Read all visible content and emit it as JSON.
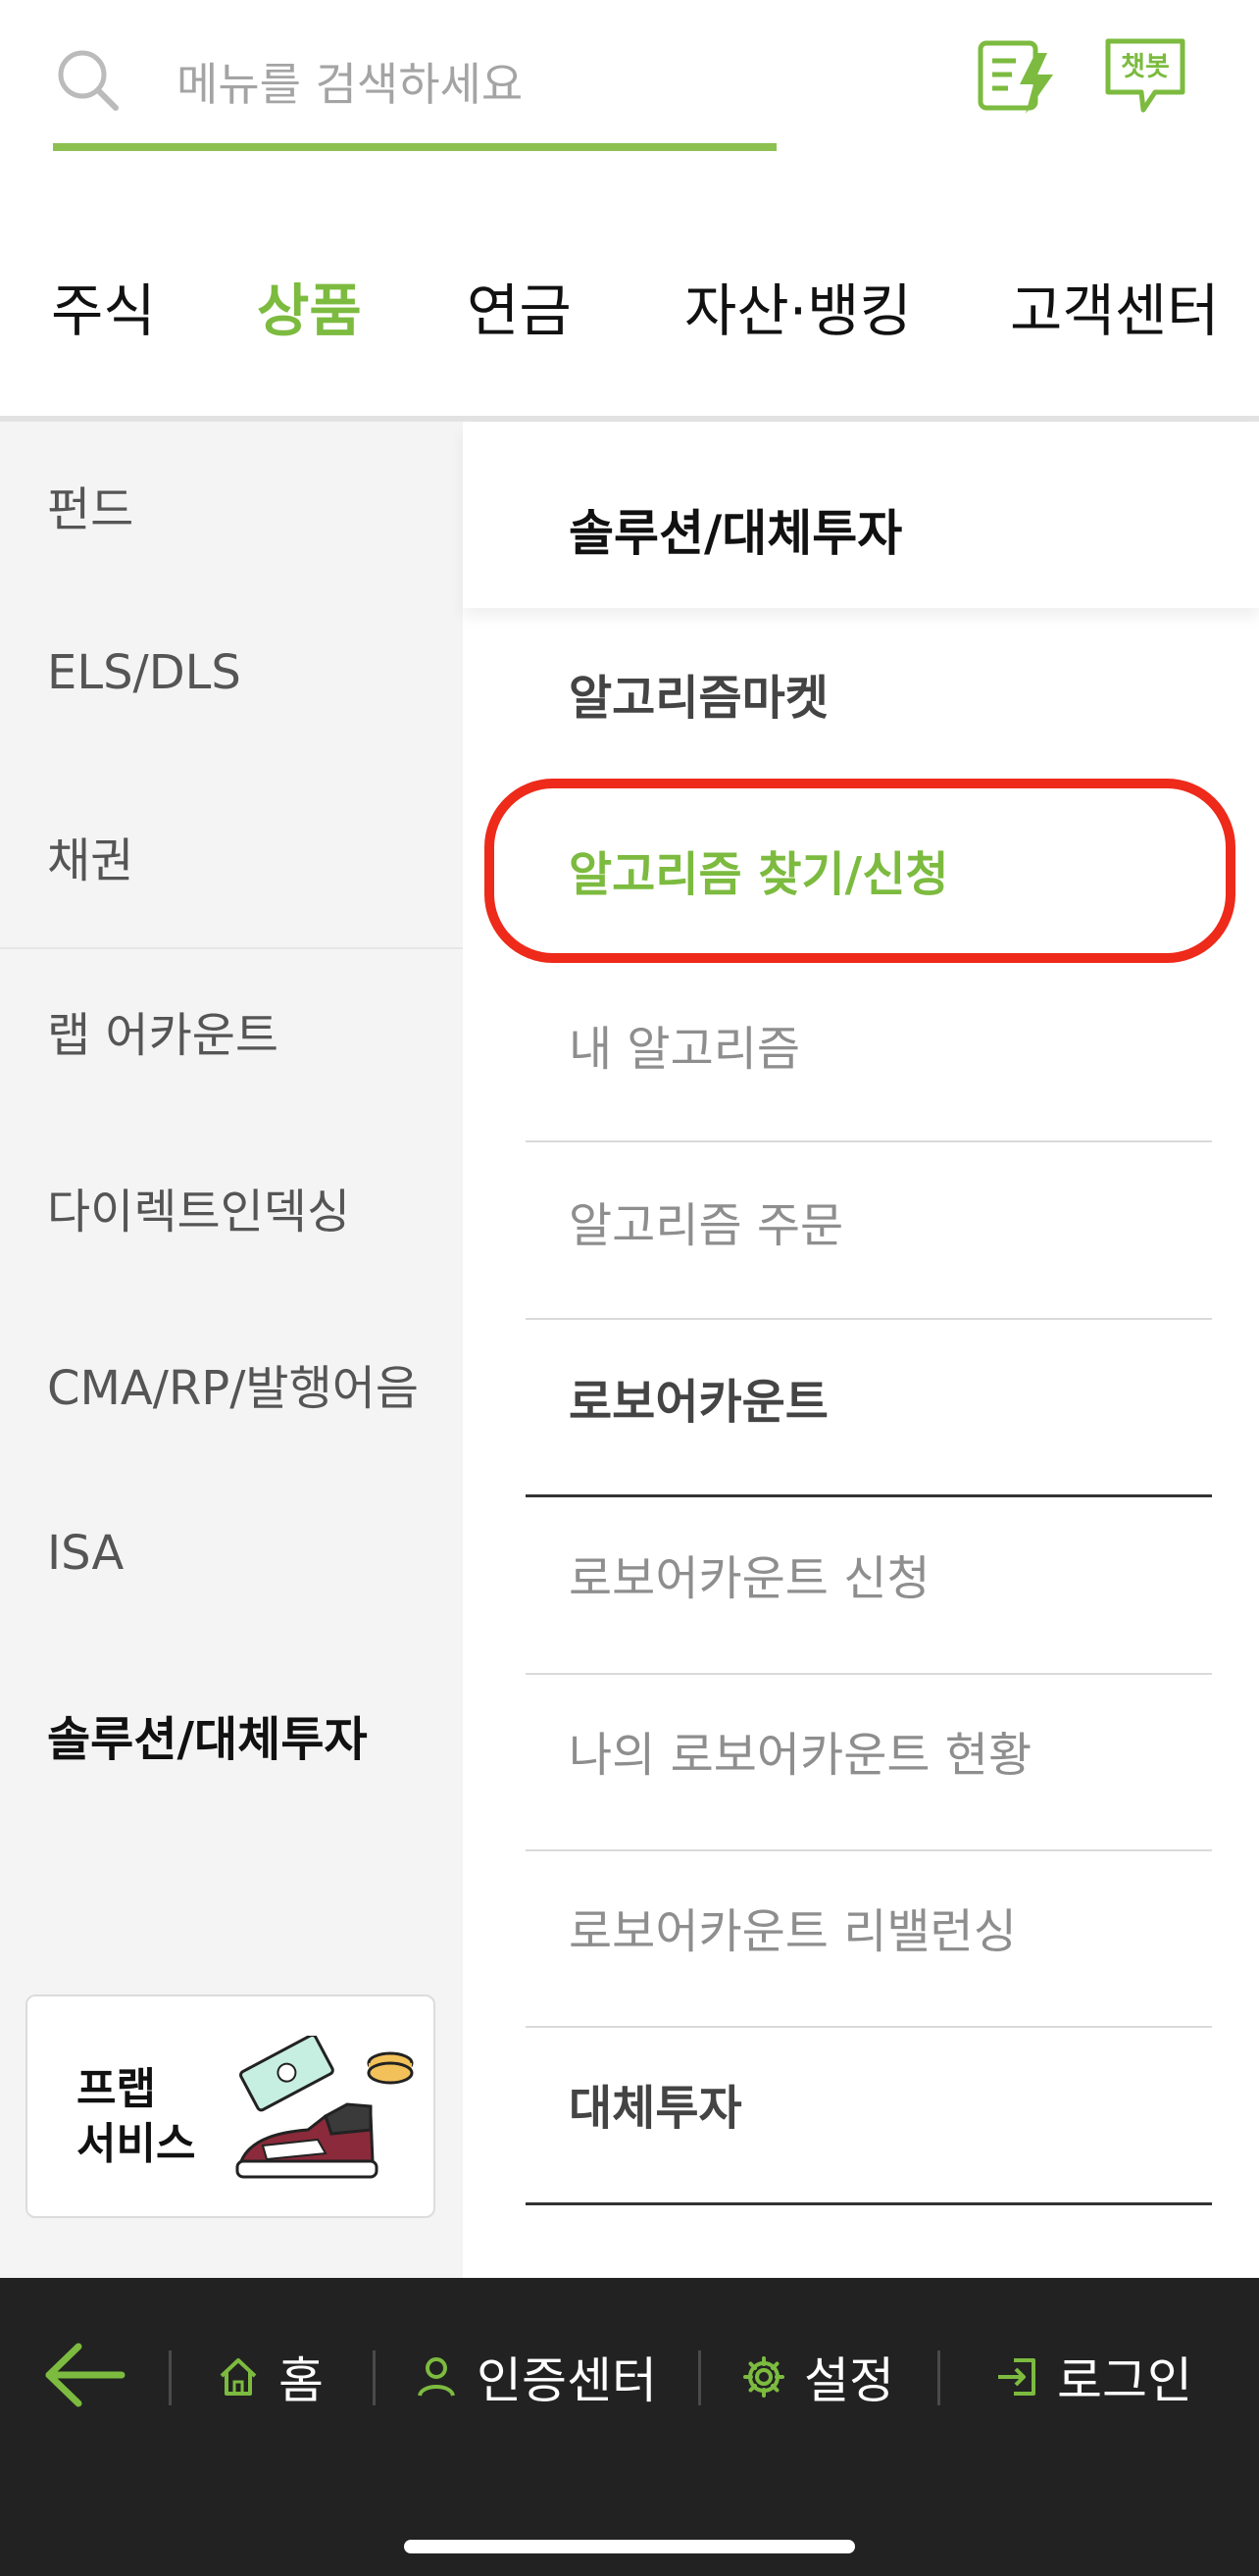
{
  "search": {
    "placeholder": "메뉴를 검색하세요"
  },
  "top_icons": {
    "quick": "quick-menu-icon",
    "chatbot_label": "챗봇"
  },
  "tabs": [
    {
      "label": "주식"
    },
    {
      "label": "상품",
      "active": true
    },
    {
      "label": "연금"
    },
    {
      "label": "자산·뱅킹"
    },
    {
      "label": "고객센터"
    }
  ],
  "left_menu": [
    {
      "label": "펀드"
    },
    {
      "label": "ELS/DLS"
    },
    {
      "label": "채권"
    },
    {
      "label": "랩 어카운트"
    },
    {
      "label": "다이렉트인덱싱"
    },
    {
      "label": "CMA/RP/발행어음"
    },
    {
      "label": "ISA"
    },
    {
      "label": "솔루션/대체투자",
      "active": true
    }
  ],
  "promo": {
    "line1": "프랩",
    "line2": "서비스"
  },
  "right_menu": {
    "header": "솔루션/대체투자",
    "items": [
      {
        "label": "알고리즘마켓",
        "type": "group"
      },
      {
        "label": "알고리즘 찾기/신청",
        "type": "selected"
      },
      {
        "label": "내 알고리즘",
        "type": "item"
      },
      {
        "label": "알고리즘 주문",
        "type": "item"
      },
      {
        "label": "로보어카운트",
        "type": "group"
      },
      {
        "label": "로보어카운트 신청",
        "type": "item"
      },
      {
        "label": "나의 로보어카운트 현황",
        "type": "item"
      },
      {
        "label": "로보어카운트 리밸런싱",
        "type": "item"
      },
      {
        "label": "대체투자",
        "type": "group"
      }
    ]
  },
  "bottom_nav": {
    "home": "홈",
    "auth_center": "인증센터",
    "settings": "설정",
    "login": "로그인"
  },
  "colors": {
    "accent": "#7cbb3f",
    "highlight": "#ee2a1a",
    "bottom_bar": "#222222"
  }
}
